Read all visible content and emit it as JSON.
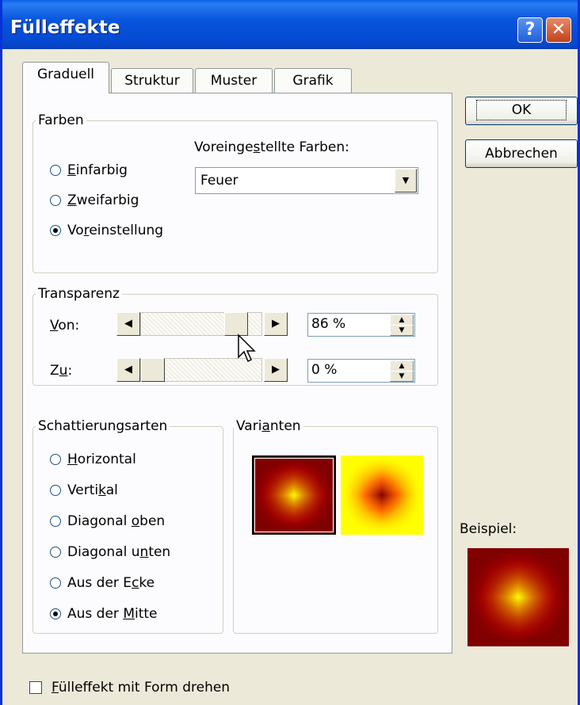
{
  "window": {
    "title": "Fülleffekte",
    "help": "?",
    "close": "✕"
  },
  "tabs": [
    "Graduell",
    "Struktur",
    "Muster",
    "Grafik"
  ],
  "colors": {
    "group_label": "Farben",
    "preset_label": "Voreingestellte Farben:",
    "preset_value": "Feuer",
    "options": [
      {
        "pre": "",
        "key": "E",
        "post": "infarbig"
      },
      {
        "pre": "",
        "key": "Z",
        "post": "weifarbig"
      },
      {
        "pre": "Vo",
        "key": "r",
        "post": "einstellung"
      }
    ],
    "selected": 2
  },
  "transparency": {
    "group_label": "Transparenz",
    "from_label": {
      "key": "V",
      "post": "on:"
    },
    "to_label": {
      "pre": "Z",
      "key": "u",
      "post": ":"
    },
    "from_value": "86 %",
    "to_value": "0 %",
    "from_level": 0.86,
    "to_level": 0
  },
  "shading": {
    "group_label": "Schattierungsarten",
    "options": [
      {
        "pre": "",
        "key": "H",
        "post": "orizontal"
      },
      {
        "pre": "Verti",
        "key": "k",
        "post": "al"
      },
      {
        "pre": "Diagonal ",
        "key": "o",
        "post": "ben"
      },
      {
        "pre": "Diagonal u",
        "key": "n",
        "post": "ten"
      },
      {
        "pre": "Aus der E",
        "key": "c",
        "post": "ke"
      },
      {
        "pre": "Aus der ",
        "key": "M",
        "post": "itte"
      }
    ],
    "selected": 5
  },
  "variants": {
    "group_label": "Varianten",
    "label_pre": "Vari",
    "label_key": "a",
    "label_post": "nten"
  },
  "buttons": {
    "ok": "OK",
    "cancel": "Abbrechen"
  },
  "sample_label": "Beispiel:",
  "rotate_checkbox": {
    "key": "F",
    "post": "ülleffekt mit Form drehen",
    "checked": false
  },
  "fire_colors": {
    "dark": "#800000",
    "red": "#ff0000",
    "orange": "#ff8000",
    "yellow": "#ffff00"
  }
}
